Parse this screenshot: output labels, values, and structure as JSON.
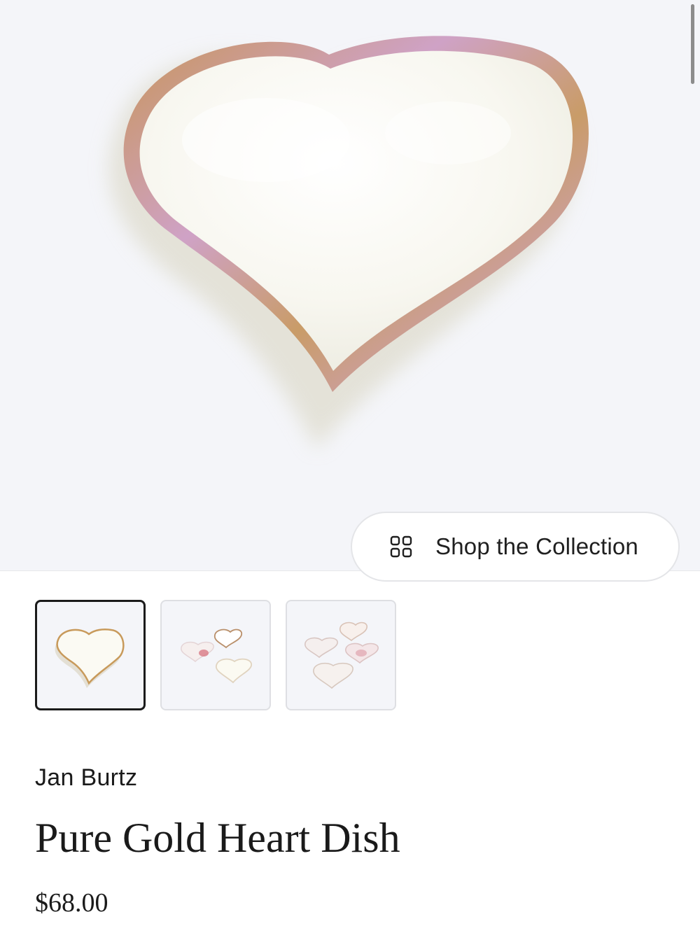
{
  "product": {
    "brand": "Jan Burtz",
    "name": "Pure Gold Heart Dish",
    "price": "$68.00"
  },
  "gallery": {
    "shop_collection_label": "Shop the Collection",
    "shop_collection_icon": "grid-icon",
    "thumbnails": [
      {
        "name": "thumbnail-single-heart",
        "selected": true
      },
      {
        "name": "thumbnail-three-hearts",
        "selected": false
      },
      {
        "name": "thumbnail-four-hearts",
        "selected": false
      }
    ]
  },
  "colors": {
    "hero_background": "#f4f5f9",
    "dish_body": "#f7f6ee",
    "dish_rim_gold": "#c89a5b",
    "dish_rim_pink": "#caa2c6",
    "active_thumb_border": "#1b1b1b"
  }
}
